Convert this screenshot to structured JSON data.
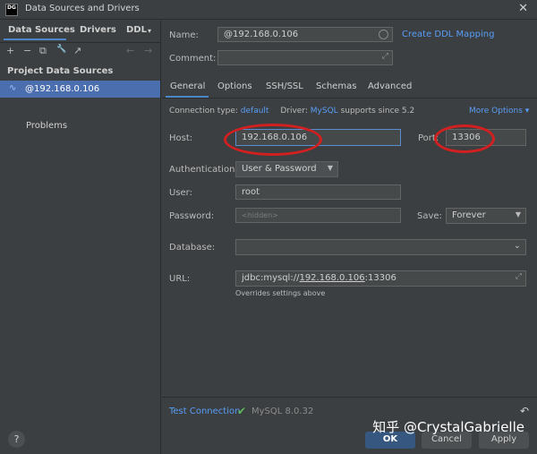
{
  "window": {
    "title": "Data Sources and Drivers",
    "app_icon_text": "DG"
  },
  "left": {
    "tabs": [
      "Data Sources",
      "Drivers",
      "DDL"
    ],
    "toolbar": [
      "+",
      "−",
      "⧉",
      "🔧",
      "↗",
      "←",
      "→"
    ],
    "section_title": "Project Data Sources",
    "datasource": "@192.168.0.106",
    "problems": "Problems"
  },
  "form": {
    "name_label": "Name:",
    "name_value": "@192.168.0.106",
    "create_ddl": "Create DDL Mapping",
    "comment_label": "Comment:",
    "tabs": [
      "General",
      "Options",
      "SSH/SSL",
      "Schemas",
      "Advanced"
    ],
    "conn_type_label": "Connection type:",
    "conn_type_value": "default",
    "driver_label": "Driver:",
    "driver_value": "MySQL",
    "driver_note": "supports since 5.2",
    "more_options": "More Options",
    "host_label": "Host:",
    "host_value": "192.168.0.106",
    "port_label": "Port:",
    "port_value": "13306",
    "auth_label": "Authentication:",
    "auth_value": "User & Password",
    "user_label": "User:",
    "user_value": "root",
    "password_label": "Password:",
    "password_value": "<hidden>",
    "save_label": "Save:",
    "save_value": "Forever",
    "database_label": "Database:",
    "url_label": "URL:",
    "url_prefix": "jdbc:mysql://",
    "url_host": "192.168.0.106",
    "url_suffix": ":13306",
    "url_note": "Overrides settings above"
  },
  "footer": {
    "test_connection": "Test Connection",
    "driver_version": "MySQL 8.0.32",
    "ok": "OK",
    "cancel": "Cancel",
    "apply": "Apply",
    "help": "?"
  },
  "watermark": "知乎 @CrystalGabrielle",
  "colors": {
    "accent": "#4a88c7",
    "link": "#589df6",
    "selection": "#4b6eaf",
    "annotation": "#d21f1f",
    "check": "#4caf50"
  }
}
